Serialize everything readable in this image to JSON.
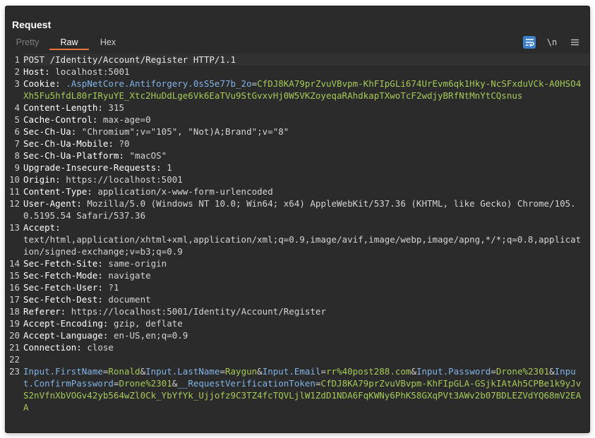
{
  "panel": {
    "title": "Request",
    "tabs": [
      "Pretty",
      "Raw",
      "Hex"
    ],
    "active_tab": "Raw",
    "toolbar": {
      "wrap_label": "",
      "newline_label": "\\n",
      "menu_label": "≡"
    }
  },
  "lines": [
    {
      "n": "1",
      "parts": [
        {
          "t": "POST /Identity/Account/Register HTTP/1.1",
          "c": "white"
        }
      ]
    },
    {
      "n": "2",
      "parts": [
        {
          "t": "Host:",
          "c": "key"
        },
        {
          "t": " localhost:5001",
          "c": "val"
        }
      ]
    },
    {
      "n": "3",
      "parts": [
        {
          "t": "Cookie:",
          "c": "key"
        },
        {
          "t": " .AspNetCore.Antiforgery.0sS5e77b_2o",
          "c": "blue"
        },
        {
          "t": "=",
          "c": "val"
        },
        {
          "t": "CfDJ8KA79prZvuVBvpm-KhFIpGLi674UrEvm6qk1Hky-NcSFxduVCk-A0HSO4Xh5Fu5hfdL80rIRyuYE_Xtc2HuDdLge6Vk6EaTVu9StGvxvHj0W5VKZoyeqaRAhdkapTXwoTcF2wdjyBRfNtMnYtCQsnus",
          "c": "green"
        }
      ]
    },
    {
      "n": "4",
      "parts": [
        {
          "t": "Content-Length:",
          "c": "key"
        },
        {
          "t": " 315",
          "c": "val"
        }
      ]
    },
    {
      "n": "5",
      "parts": [
        {
          "t": "Cache-Control:",
          "c": "key"
        },
        {
          "t": " max-age=0",
          "c": "val"
        }
      ]
    },
    {
      "n": "6",
      "parts": [
        {
          "t": "Sec-Ch-Ua:",
          "c": "key"
        },
        {
          "t": " \"Chromium\";v=\"105\", \"Not)A;Brand\";v=\"8\"",
          "c": "val"
        }
      ]
    },
    {
      "n": "7",
      "parts": [
        {
          "t": "Sec-Ch-Ua-Mobile:",
          "c": "key"
        },
        {
          "t": " ?0",
          "c": "val"
        }
      ]
    },
    {
      "n": "8",
      "parts": [
        {
          "t": "Sec-Ch-Ua-Platform:",
          "c": "key"
        },
        {
          "t": " \"macOS\"",
          "c": "val"
        }
      ]
    },
    {
      "n": "9",
      "parts": [
        {
          "t": "Upgrade-Insecure-Requests:",
          "c": "key"
        },
        {
          "t": " 1",
          "c": "val"
        }
      ]
    },
    {
      "n": "10",
      "parts": [
        {
          "t": "Origin:",
          "c": "key"
        },
        {
          "t": " https://localhost:5001",
          "c": "val"
        }
      ]
    },
    {
      "n": "11",
      "parts": [
        {
          "t": "Content-Type:",
          "c": "key"
        },
        {
          "t": " application/x-www-form-urlencoded",
          "c": "val"
        }
      ]
    },
    {
      "n": "12",
      "parts": [
        {
          "t": "User-Agent:",
          "c": "key"
        },
        {
          "t": " Mozilla/5.0 (Windows NT 10.0; Win64; x64) AppleWebKit/537.36 (KHTML, like Gecko) Chrome/105.0.5195.54 Safari/537.36",
          "c": "val"
        }
      ]
    },
    {
      "n": "13",
      "parts": [
        {
          "t": "Accept:",
          "c": "key"
        },
        {
          "t": "\ntext/html,application/xhtml+xml,application/xml;q=0.9,image/avif,image/webp,image/apng,*/*;q=0.8,application/signed-exchange;v=b3;q=0.9",
          "c": "val"
        }
      ]
    },
    {
      "n": "14",
      "parts": [
        {
          "t": "Sec-Fetch-Site:",
          "c": "key"
        },
        {
          "t": " same-origin",
          "c": "val"
        }
      ]
    },
    {
      "n": "15",
      "parts": [
        {
          "t": "Sec-Fetch-Mode:",
          "c": "key"
        },
        {
          "t": " navigate",
          "c": "val"
        }
      ]
    },
    {
      "n": "16",
      "parts": [
        {
          "t": "Sec-Fetch-User:",
          "c": "key"
        },
        {
          "t": " ?1",
          "c": "val"
        }
      ]
    },
    {
      "n": "17",
      "parts": [
        {
          "t": "Sec-Fetch-Dest:",
          "c": "key"
        },
        {
          "t": " document",
          "c": "val"
        }
      ]
    },
    {
      "n": "18",
      "parts": [
        {
          "t": "Referer:",
          "c": "key"
        },
        {
          "t": " https://localhost:5001/Identity/Account/Register",
          "c": "val"
        }
      ]
    },
    {
      "n": "19",
      "parts": [
        {
          "t": "Accept-Encoding:",
          "c": "key"
        },
        {
          "t": " gzip, deflate",
          "c": "val"
        }
      ]
    },
    {
      "n": "20",
      "parts": [
        {
          "t": "Accept-Language:",
          "c": "key"
        },
        {
          "t": " en-US,en;q=0.9",
          "c": "val"
        }
      ]
    },
    {
      "n": "21",
      "parts": [
        {
          "t": "Connection:",
          "c": "key"
        },
        {
          "t": " close",
          "c": "val"
        }
      ]
    },
    {
      "n": "22",
      "parts": [
        {
          "t": "",
          "c": "val"
        }
      ]
    },
    {
      "n": "23",
      "parts": [
        {
          "t": "Input.FirstName",
          "c": "blue"
        },
        {
          "t": "=",
          "c": "val"
        },
        {
          "t": "Ronald",
          "c": "green"
        },
        {
          "t": "&",
          "c": "val"
        },
        {
          "t": "Input.LastName",
          "c": "blue"
        },
        {
          "t": "=",
          "c": "val"
        },
        {
          "t": "Raygun",
          "c": "green"
        },
        {
          "t": "&",
          "c": "val"
        },
        {
          "t": "Input.Email",
          "c": "blue"
        },
        {
          "t": "=",
          "c": "val"
        },
        {
          "t": "rr%40post288.com",
          "c": "green"
        },
        {
          "t": "&",
          "c": "val"
        },
        {
          "t": "Input.Password",
          "c": "blue"
        },
        {
          "t": "=",
          "c": "val"
        },
        {
          "t": "Drone%2301",
          "c": "green"
        },
        {
          "t": "&",
          "c": "val"
        },
        {
          "t": "Input.ConfirmPassword",
          "c": "blue"
        },
        {
          "t": "=",
          "c": "val"
        },
        {
          "t": "Drone%2301",
          "c": "green"
        },
        {
          "t": "&",
          "c": "val"
        },
        {
          "t": "__RequestVerificationToken",
          "c": "blue"
        },
        {
          "t": "=",
          "c": "val"
        },
        {
          "t": "CfDJ8KA79prZvuVBvpm-KhFIpGLA-GSjkIAtAh5CPBe1k9yJvS2nVfnXbVOGv42yb564wZl0Ck_YbYfYk_Ujjofz9C3TZ4fcTQVLjlW1ZdD1NDA6FqKWNy6PhK58GXqPVt3AWv2b07BDLEZVdYQ68mV2EAA",
          "c": "green"
        }
      ]
    }
  ],
  "colors": {
    "background": "#2b2b2b",
    "accent": "#e8743b",
    "key": "#ffffff",
    "value": "#d4d4d4",
    "param_name": "#82b3e6",
    "param_value": "#a6c957",
    "active_button": "#3f7ec9"
  }
}
